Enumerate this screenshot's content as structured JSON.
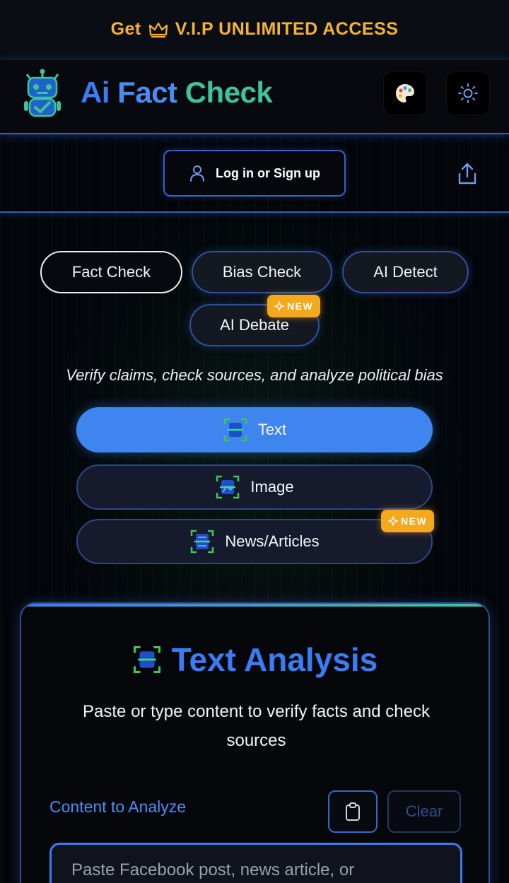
{
  "vip": {
    "prefix": "Get",
    "label": "V.I.P UNLIMITED ACCESS",
    "color": "#f5b332"
  },
  "header": {
    "title_part1": "Ai ",
    "title_part2": "Fact ",
    "title_part3": "Check",
    "palette_icon": "palette-icon",
    "theme_icon": "sun-icon"
  },
  "auth": {
    "login_label": "Log in or Sign up",
    "share_icon": "share-icon"
  },
  "modes": [
    {
      "label": "Fact Check",
      "active": true
    },
    {
      "label": "Bias Check",
      "active": false
    },
    {
      "label": "AI Detect",
      "active": false
    },
    {
      "label": "AI Debate",
      "active": false,
      "badge": "NEW"
    }
  ],
  "tagline": "Verify claims, check sources, and analyze political bias",
  "input_types": [
    {
      "label": "Text",
      "active": true
    },
    {
      "label": "Image",
      "active": false
    },
    {
      "label": "News/Articles",
      "active": false,
      "badge": "NEW"
    }
  ],
  "analysis": {
    "title": "Text Analysis",
    "subtitle": "Paste or type content to verify facts and check sources",
    "content_label": "Content to Analyze",
    "clear_label": "Clear",
    "placeholder": "Paste Facebook post, news article, or"
  },
  "colors": {
    "accent": "#3b7cf2",
    "accent_green": "#3fc49a",
    "badge": "#f4a81d"
  }
}
